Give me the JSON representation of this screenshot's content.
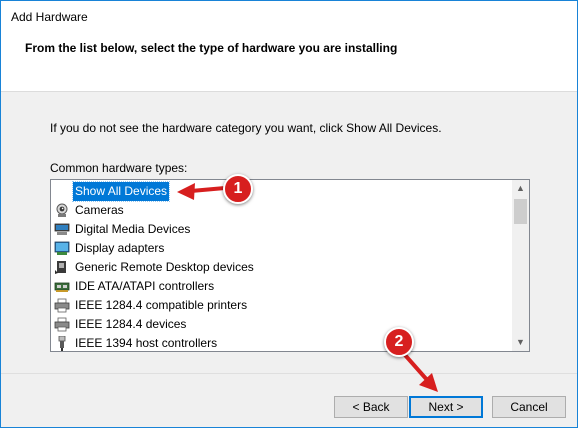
{
  "window": {
    "title": "Add Hardware",
    "subtitle": "From the list below, select the type of hardware you are installing"
  },
  "main": {
    "instruction": "If you do not see the hardware category you want, click Show All Devices.",
    "list_label": "Common hardware types:",
    "items": [
      {
        "label": "Show All Devices",
        "icon": "none",
        "selected": true
      },
      {
        "label": "Cameras",
        "icon": "camera-icon",
        "selected": false
      },
      {
        "label": "Digital Media Devices",
        "icon": "media-device-icon",
        "selected": false
      },
      {
        "label": "Display adapters",
        "icon": "display-adapter-icon",
        "selected": false
      },
      {
        "label": "Generic Remote Desktop devices",
        "icon": "remote-desktop-icon",
        "selected": false
      },
      {
        "label": "IDE ATA/ATAPI controllers",
        "icon": "ide-controller-icon",
        "selected": false
      },
      {
        "label": "IEEE 1284.4 compatible printers",
        "icon": "printer-icon",
        "selected": false
      },
      {
        "label": "IEEE 1284.4 devices",
        "icon": "printer-icon",
        "selected": false
      },
      {
        "label": "IEEE 1394 host controllers",
        "icon": "usb-plug-icon",
        "selected": false
      }
    ]
  },
  "buttons": {
    "back": "< Back",
    "next": "Next >",
    "cancel": "Cancel"
  },
  "annotations": {
    "step1": "1",
    "step2": "2",
    "color": "#d71f1f"
  },
  "colors": {
    "selection": "#0078d7",
    "window_border": "#1883d7"
  }
}
